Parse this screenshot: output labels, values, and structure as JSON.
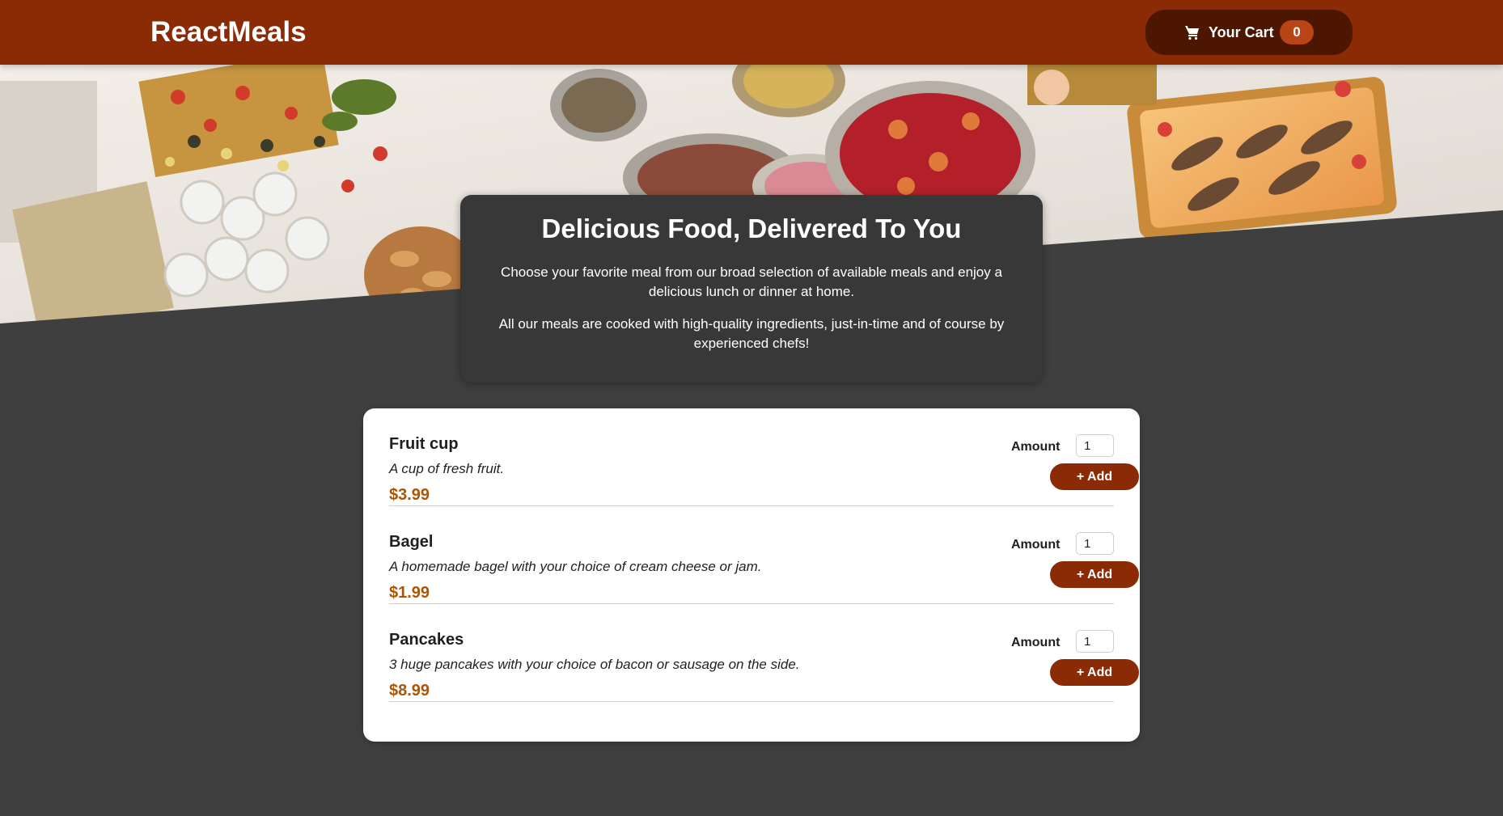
{
  "header": {
    "brand": "ReactMeals",
    "cart": {
      "label": "Your Cart",
      "count": "0",
      "icon": "cart-icon"
    }
  },
  "summary": {
    "title": "Delicious Food, Delivered To You",
    "paragraph1": "Choose your favorite meal from our broad selection of available meals and enjoy a delicious lunch or dinner at home.",
    "paragraph2": "All our meals are cooked with high-quality ingredients, just-in-time and of course by experienced chefs!"
  },
  "meals": [
    {
      "name": "Fruit cup",
      "description": "A cup of fresh fruit.",
      "price": "$3.99",
      "amount_label": "Amount",
      "amount_value": "1",
      "add_label": "+ Add"
    },
    {
      "name": "Bagel",
      "description": "A homemade bagel with your choice of cream cheese or jam.",
      "price": "$1.99",
      "amount_label": "Amount",
      "amount_value": "1",
      "add_label": "+ Add"
    },
    {
      "name": "Pancakes",
      "description": "3 huge pancakes with your choice of bacon or sausage on the side.",
      "price": "$8.99",
      "amount_label": "Amount",
      "amount_value": "1",
      "add_label": "+ Add"
    }
  ],
  "colors": {
    "header": "#8a2b06",
    "cart_button": "#4d1601",
    "cart_badge": "#b94517",
    "background": "#3f3f3f",
    "summary_card": "#383838",
    "price": "#ad5502",
    "add_button": "#8a2b06"
  }
}
